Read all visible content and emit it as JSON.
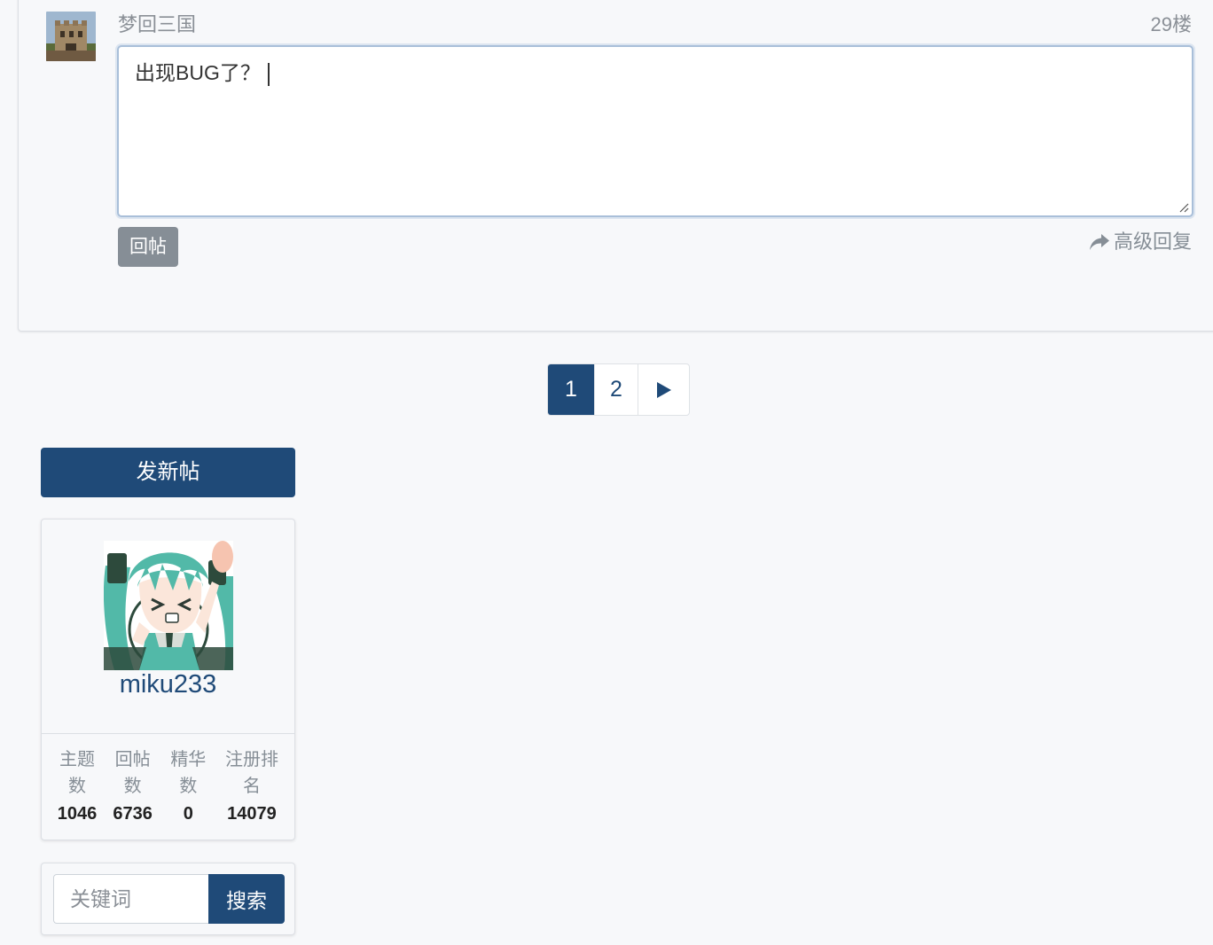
{
  "reply": {
    "username": "梦回三国",
    "floor": "29楼",
    "text": "出现BUG了？",
    "submit_label": "回帖",
    "advanced_label": "高级回复"
  },
  "pagination": {
    "pages": [
      "1",
      "2"
    ],
    "active_page": "1"
  },
  "sidebar": {
    "new_post_label": "发新帖",
    "profile": {
      "username": "miku233",
      "stats": [
        {
          "label": "主题数",
          "value": "1046"
        },
        {
          "label": "回帖数",
          "value": "6736"
        },
        {
          "label": "精华数",
          "value": "0"
        },
        {
          "label": "注册排名",
          "value": "14079"
        }
      ]
    },
    "search": {
      "placeholder": "关键词",
      "button_label": "搜索"
    }
  },
  "colors": {
    "primary": "#1f4a78",
    "muted": "#868e96",
    "background": "#f7f8fa"
  }
}
